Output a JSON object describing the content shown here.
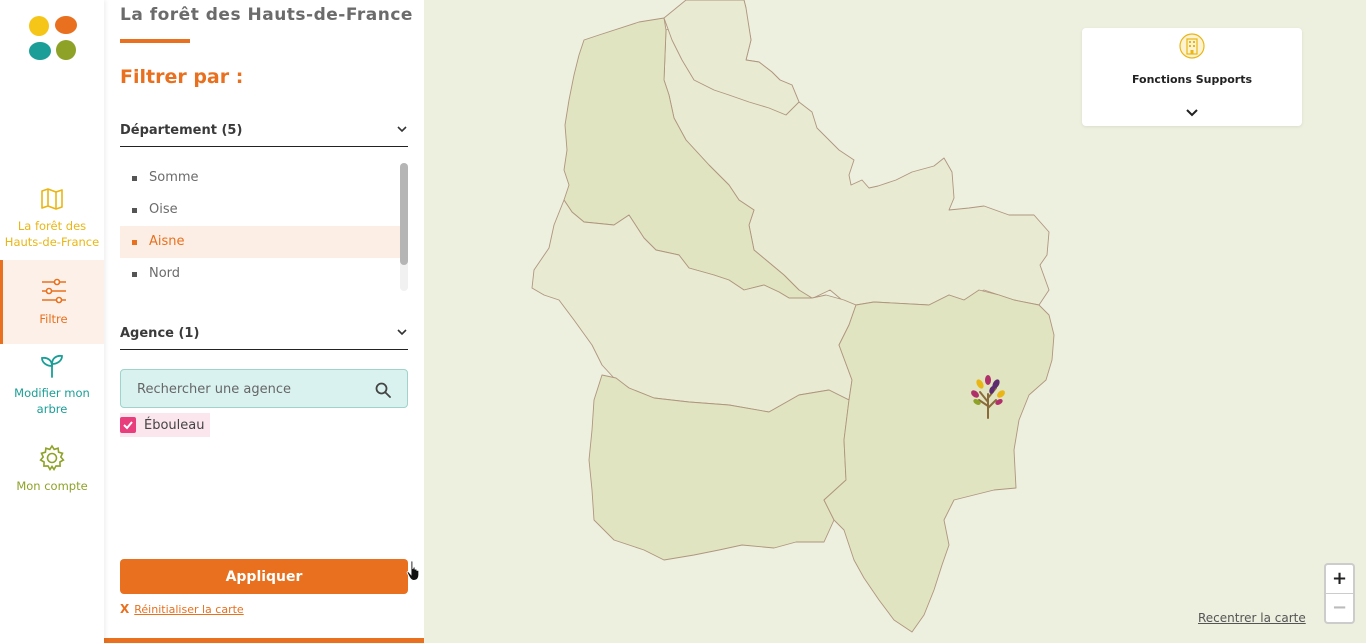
{
  "colors": {
    "brand_orange": "#e8701e",
    "nav_yellow": "#e9b615",
    "nav_teal": "#1a9e97",
    "nav_green": "#8fa228",
    "checkbox_pink": "#e83e7b",
    "region_fill": "#e0e4c0",
    "map_background": "#edefdf"
  },
  "logo": {
    "icon": "four-petal-logo-icon"
  },
  "nav": {
    "items": [
      {
        "label": "La forêt des Hauts-de-France",
        "icon": "map-icon",
        "active": false
      },
      {
        "label": "Filtre",
        "icon": "sliders-icon",
        "active": true
      },
      {
        "label": "Modifier mon arbre",
        "icon": "sprout-icon",
        "active": false
      },
      {
        "label": "Mon compte",
        "icon": "gear-icon",
        "active": false
      }
    ]
  },
  "panel": {
    "title": "La forêt des Hauts-de-France",
    "filter_heading": "Filtrer par :",
    "departement": {
      "label": "Département (5)",
      "items": [
        "Somme",
        "Oise",
        "Aisne",
        "Nord"
      ],
      "selected": "Aisne"
    },
    "agence": {
      "label": "Agence (1)",
      "search_placeholder": "Rechercher une agence",
      "options": [
        {
          "label": "Ébouleau",
          "checked": true
        }
      ]
    },
    "apply_label": "Appliquer",
    "reset_x": "X",
    "reset_label": "Réinitialiser la carte"
  },
  "map": {
    "support_card": {
      "label": "Fonctions Supports",
      "icon": "building-icon"
    },
    "marker": {
      "icon": "tree-icon"
    },
    "zoom_in": "+",
    "zoom_out": "−",
    "recenter_label": "Recentrer la carte"
  }
}
